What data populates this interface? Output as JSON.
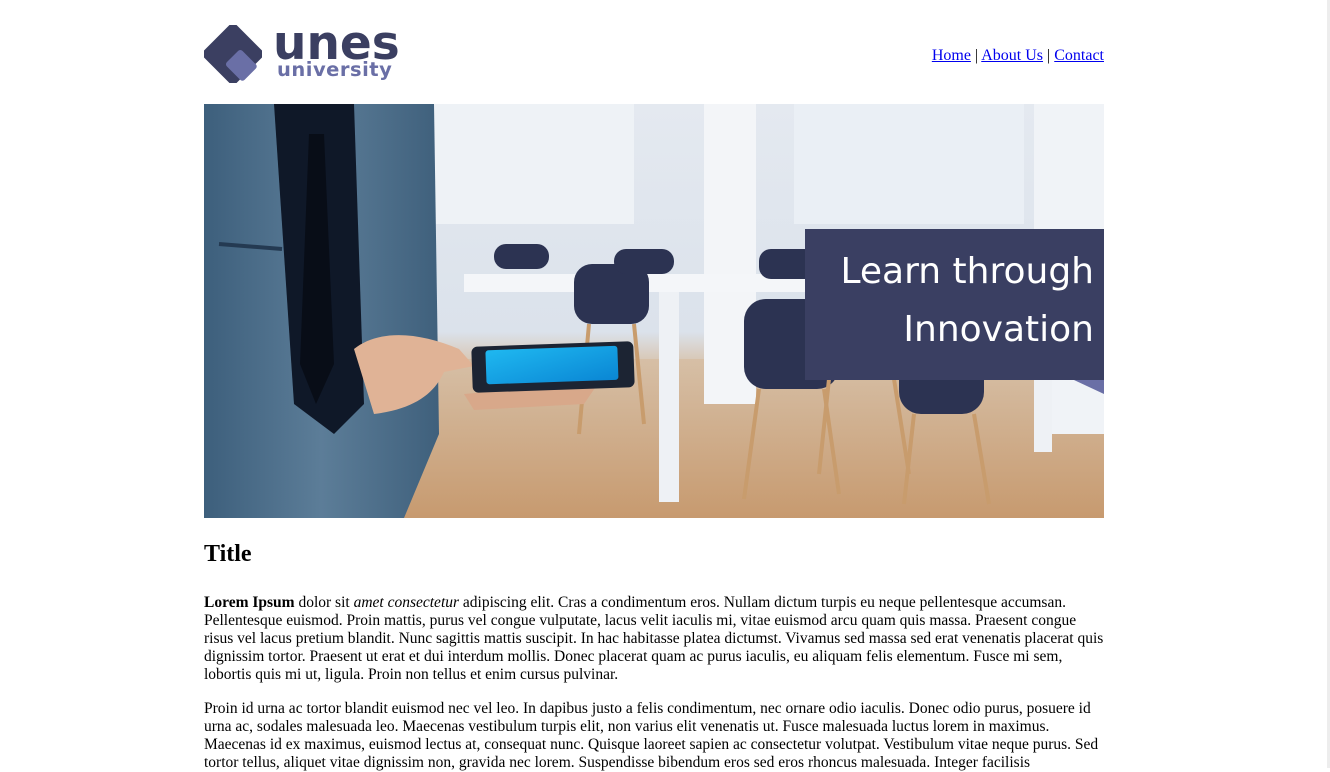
{
  "brand": {
    "name": "unes",
    "subtitle": "university",
    "mark_colors": {
      "dark": "#3b3f61",
      "light": "#6a6fa6"
    }
  },
  "nav": {
    "items": [
      "Home",
      "About Us",
      "Contact"
    ],
    "separator": " | "
  },
  "hero": {
    "tagline_line1": "Learn through",
    "tagline_line2": "Innovation",
    "banner_color": "#3a3f62"
  },
  "article": {
    "title": "Title",
    "p1_bold": "Lorem Ipsum",
    "p1_text_a": " dolor sit ",
    "p1_italic": "amet consectetur",
    "p1_text_b": " adipiscing elit. Cras a condimentum eros. Nullam dictum turpis eu neque pellentesque accumsan. Pellentesque euismod. Proin mattis, purus vel congue vulputate, lacus velit iaculis mi, vitae euismod arcu quam quis massa. Praesent congue risus vel lacus pretium blandit. Nunc sagittis mattis suscipit. In hac habitasse platea dictumst. Vivamus sed massa sed erat venenatis placerat quis dignissim tortor. Praesent ut erat et dui interdum mollis. Donec placerat quam ac purus iaculis, eu aliquam felis elementum. Fusce mi sem, lobortis quis mi ut, ligula. Proin non tellus et enim cursus pulvinar.",
    "p2": "Proin id urna ac tortor blandit euismod nec vel leo. In dapibus justo a felis condimentum, nec ornare odio iaculis. Donec odio purus, posuere id urna ac, sodales malesuada leo. Maecenas vestibulum turpis elit, non varius elit venenatis ut. Fusce malesuada luctus lorem in maximus. Maecenas id ex maximus, euismod lectus at, consequat nunc. Quisque laoreet sapien ac consectetur volutpat. Vestibulum vitae neque purus. Sed tortor tellus, aliquet vitae dignissim non, gravida nec lorem. Suspendisse bibendum eros sed eros rhoncus malesuada. Integer facilisis"
  }
}
